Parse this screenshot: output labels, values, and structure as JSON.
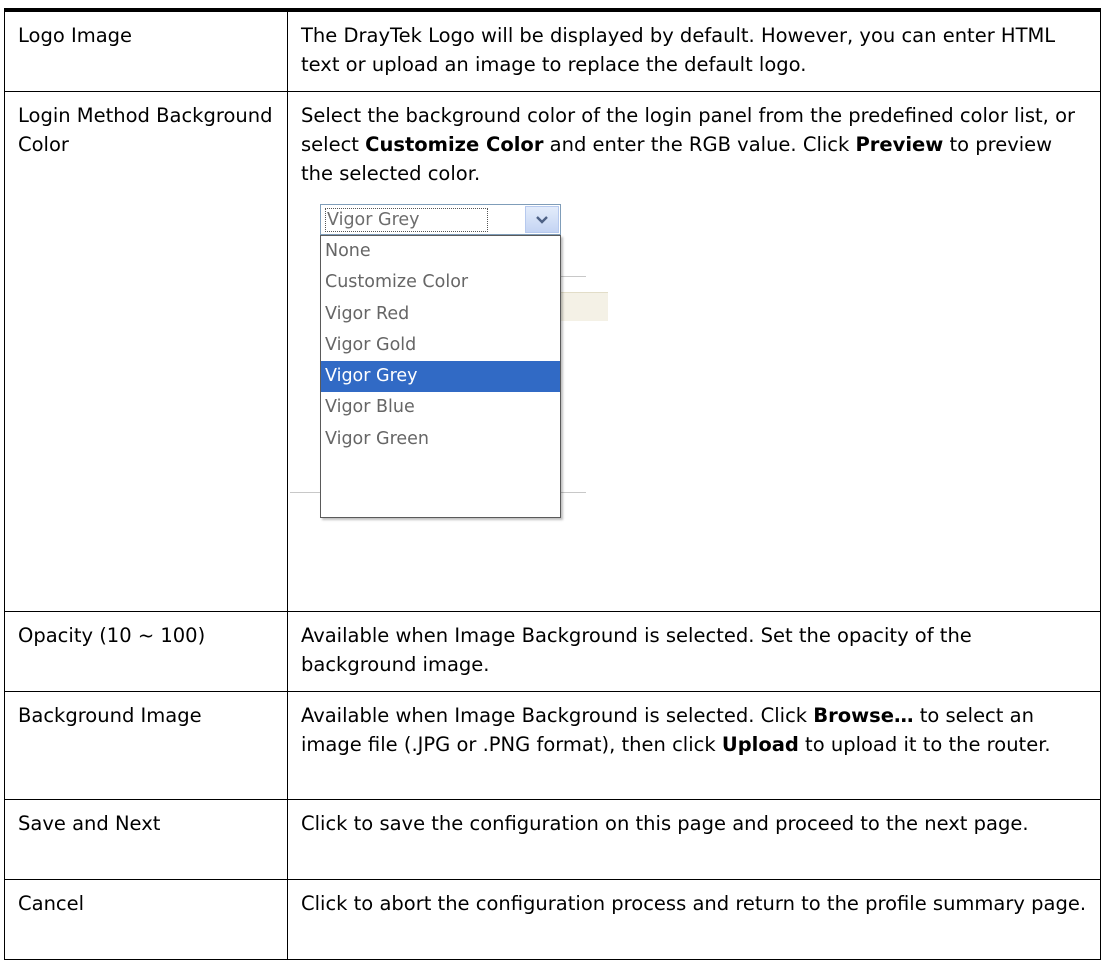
{
  "rows": [
    {
      "term": "Logo Image",
      "description": "The DrayTek Logo will be displayed by default. However, you can enter HTML text or upload an image to replace the default logo."
    },
    {
      "term": "Login Method Background Color",
      "desc_part1": "Select the background color of the login panel from the predefined color list, or select ",
      "desc_bold1": "Customize Color",
      "desc_part2": " and enter the RGB value. Click ",
      "desc_bold2": "Preview",
      "desc_part3": " to preview the selected color."
    },
    {
      "term": "Opacity (10 ~ 100)",
      "description": "Available when Image Background is selected. Set the opacity of the background image."
    },
    {
      "term": "Background Image",
      "desc_part1": "Available when Image Background is selected. Click ",
      "desc_bold1": "Browse…",
      "desc_part2": " to select an image file (.JPG or .PNG format), then click ",
      "desc_bold2": "Upload",
      "desc_part3": " to upload it to the router."
    },
    {
      "term": "Save and Next",
      "description": "Click to save the configuration on this page and proceed to the next page."
    },
    {
      "term": "Cancel",
      "description": "Click to abort the configuration process and return to the profile summary page."
    }
  ],
  "color_dropdown": {
    "selected_value": "Vigor Grey",
    "options": [
      "None",
      "Customize Color",
      "Vigor Red",
      "Vigor Gold",
      "Vigor Grey",
      "Vigor Blue",
      "Vigor Green"
    ],
    "highlight_color": "#316ac5",
    "arrow_icon": "chevron-down-icon"
  }
}
